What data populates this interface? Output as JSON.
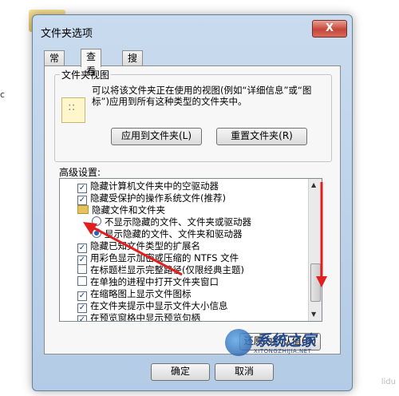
{
  "background": {
    "stray_char": "c"
  },
  "dialog": {
    "title": "文件夹选项",
    "close_glyph": "X",
    "tabs": [
      {
        "label": "常规",
        "active": false
      },
      {
        "label": "查看",
        "active": true
      },
      {
        "label": "搜索",
        "active": false
      }
    ],
    "folder_view": {
      "group_label": "文件夹视图",
      "description": "可以将该文件夹正在使用的视图(例如“详细信息”或“图标”)应用到所有这种类型的文件夹中。",
      "apply_button": "应用到文件夹(L)",
      "reset_button": "重置文件夹(R)"
    },
    "advanced": {
      "label": "高级设置:",
      "items": [
        {
          "kind": "checkbox",
          "checked": true,
          "text": "隐藏计算机文件夹中的空驱动器"
        },
        {
          "kind": "checkbox",
          "checked": true,
          "text": "隐藏受保护的操作系统文件(推荐)"
        },
        {
          "kind": "folder",
          "text": "隐藏文件和文件夹"
        },
        {
          "kind": "radio",
          "checked": false,
          "text": "不显示隐藏的文件、文件夹或驱动器"
        },
        {
          "kind": "radio",
          "checked": true,
          "text": "显示隐藏的文件、文件夹和驱动器"
        },
        {
          "kind": "checkbox",
          "checked": true,
          "text": "隐藏已知文件类型的扩展名"
        },
        {
          "kind": "checkbox",
          "checked": true,
          "text": "用彩色显示加密或压缩的 NTFS 文件"
        },
        {
          "kind": "checkbox",
          "checked": false,
          "text": "在标题栏显示完整路径(仅限经典主题)"
        },
        {
          "kind": "checkbox",
          "checked": false,
          "text": "在单独的进程中打开文件夹窗口"
        },
        {
          "kind": "checkbox",
          "checked": true,
          "text": "在缩略图上显示文件图标"
        },
        {
          "kind": "checkbox",
          "checked": true,
          "text": "在文件夹提示中显示文件大小信息"
        },
        {
          "kind": "checkbox",
          "checked": true,
          "text": "在预览窗格中显示预览句柄"
        }
      ],
      "restore_button": "还原为默认值(D)"
    },
    "ok_button": "确定",
    "cancel_button": "取消"
  },
  "watermark": {
    "text": "系统之家",
    "sub": "XITONGZHIJIA.NET",
    "corner": "lidu"
  },
  "colors": {
    "annotation_red": "#e21f1f",
    "dialog_blue": "#b9cfe8"
  }
}
